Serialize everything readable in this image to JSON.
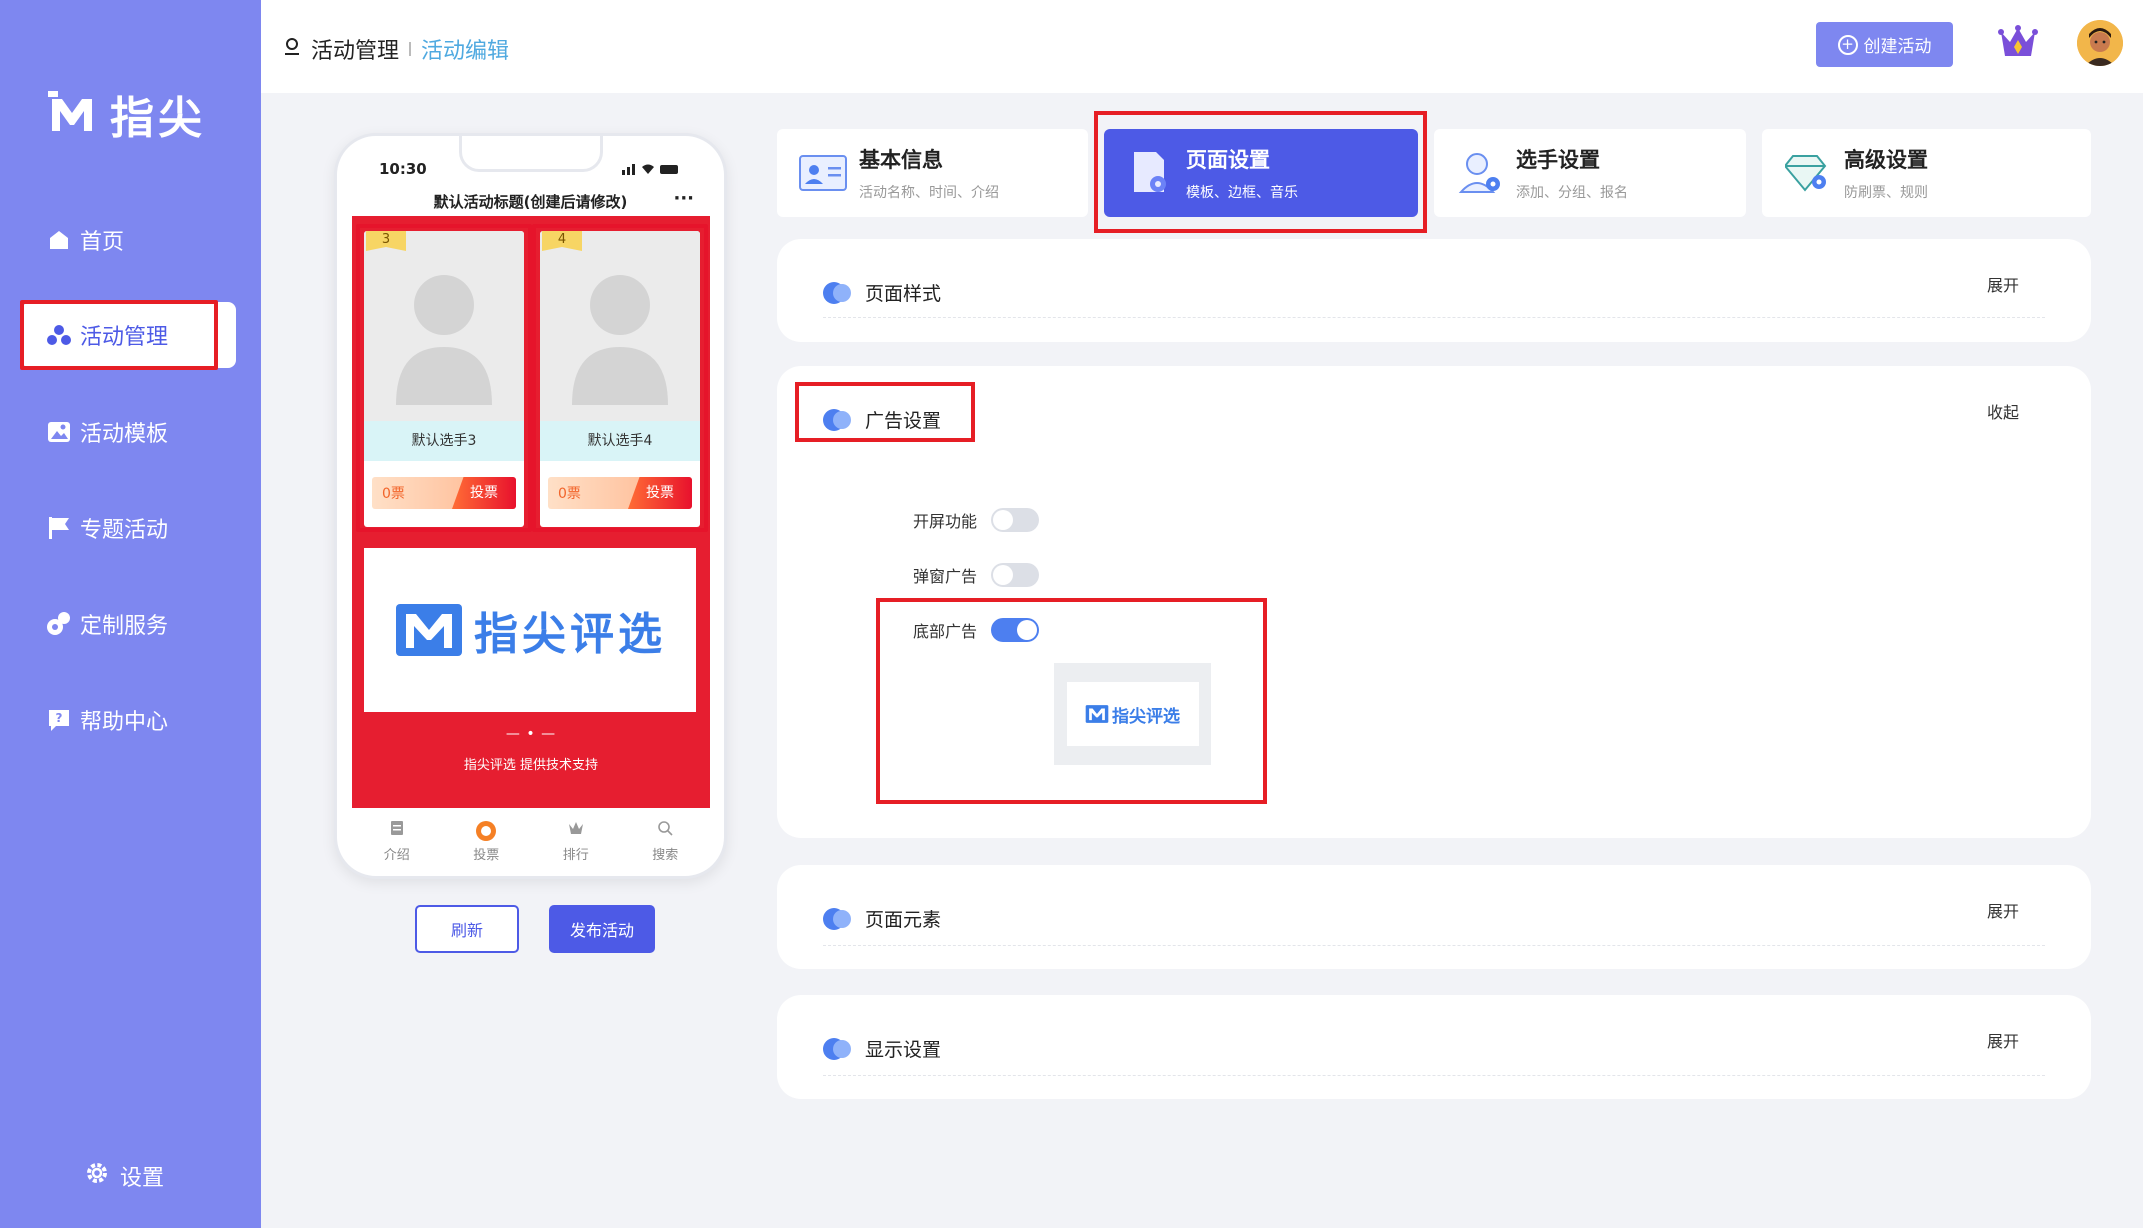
{
  "app": {
    "brand": "指尖"
  },
  "sidebar": {
    "items": [
      {
        "label": "首页",
        "icon": "home-icon"
      },
      {
        "label": "活动管理",
        "icon": "activity-icon"
      },
      {
        "label": "活动模板",
        "icon": "template-icon"
      },
      {
        "label": "专题活动",
        "icon": "flag-icon"
      },
      {
        "label": "定制服务",
        "icon": "custom-service-icon"
      },
      {
        "label": "帮助中心",
        "icon": "help-icon"
      }
    ],
    "active_index": 1,
    "settings_label": "设置"
  },
  "header": {
    "breadcrumb": {
      "parent": "活动管理",
      "current": "活动编辑"
    },
    "create_button": "创建活动"
  },
  "phone": {
    "time": "10:30",
    "title": "默认活动标题(创建后请修改)",
    "more": "···",
    "candidates": [
      {
        "rank": "3",
        "name": "默认选手3",
        "votes": "0票",
        "vote_label": "投票"
      },
      {
        "rank": "4",
        "name": "默认选手4",
        "votes": "0票",
        "vote_label": "投票"
      }
    ],
    "ad_text": "指尖评选",
    "footer_line": "— • —",
    "footer_text": "指尖评选 提供技术支持",
    "tabs": [
      {
        "label": "介绍",
        "icon": "intro-icon"
      },
      {
        "label": "投票",
        "icon": "vote-icon"
      },
      {
        "label": "排行",
        "icon": "rank-icon"
      },
      {
        "label": "搜索",
        "icon": "search-icon"
      }
    ]
  },
  "actions": {
    "refresh": "刷新",
    "publish": "发布活动"
  },
  "setting_tabs": [
    {
      "title": "基本信息",
      "sub": "活动名称、时间、介绍",
      "icon": "id-card-icon"
    },
    {
      "title": "页面设置",
      "sub": "模板、边框、音乐",
      "icon": "page-settings-icon",
      "active": true
    },
    {
      "title": "选手设置",
      "sub": "添加、分组、报名",
      "icon": "user-settings-icon"
    },
    {
      "title": "高级设置",
      "sub": "防刷票、规则",
      "icon": "diamond-icon"
    }
  ],
  "panels": {
    "page_style": {
      "title": "页面样式",
      "action": "展开"
    },
    "ad_settings": {
      "title": "广告设置",
      "action": "收起",
      "rows": [
        {
          "label": "开屏功能",
          "on": false
        },
        {
          "label": "弹窗广告",
          "on": false
        },
        {
          "label": "底部广告",
          "on": true
        }
      ],
      "preview_text": "指尖评选"
    },
    "page_elements": {
      "title": "页面元素",
      "action": "展开"
    },
    "display_settings": {
      "title": "显示设置",
      "action": "展开"
    }
  },
  "colors": {
    "sidebar": "#7e87f0",
    "primary": "#4d5ae6",
    "highlight": "#e61e25",
    "phone_bg": "#e61e30"
  }
}
